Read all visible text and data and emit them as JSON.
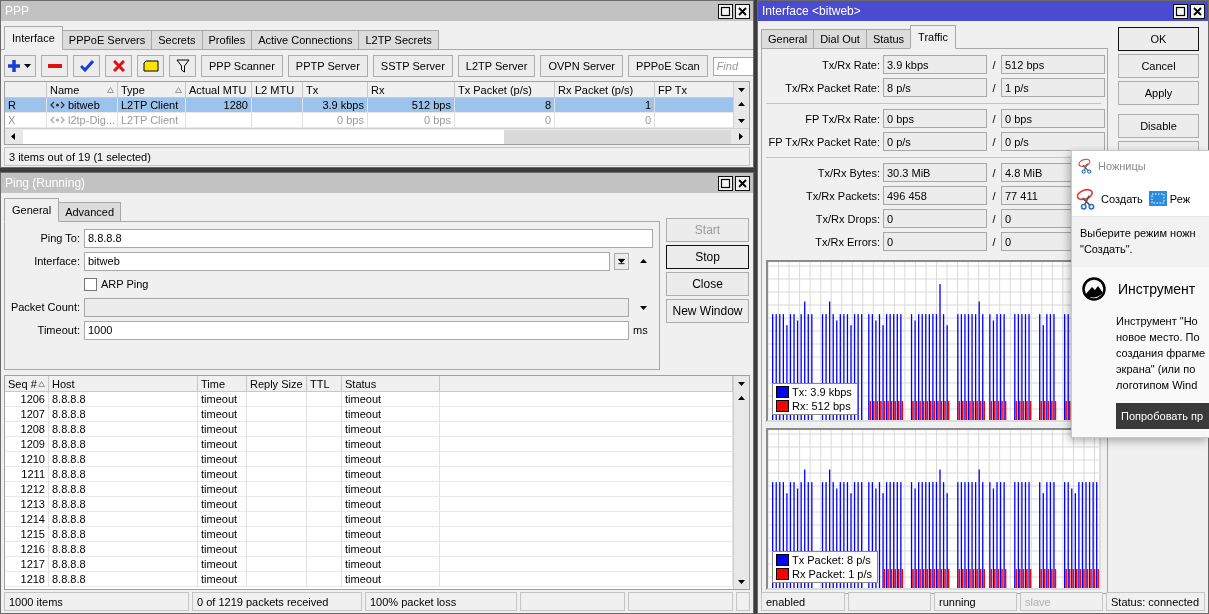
{
  "ppp": {
    "title": "PPP",
    "active": false,
    "tabs": [
      {
        "label": "Interface",
        "selected": true
      },
      {
        "label": "PPPoE Servers",
        "selected": false
      },
      {
        "label": "Secrets",
        "selected": false
      },
      {
        "label": "Profiles",
        "selected": false
      },
      {
        "label": "Active Connections",
        "selected": false
      },
      {
        "label": "L2TP Secrets",
        "selected": false
      }
    ],
    "toolbar_buttons": [
      "PPP Scanner",
      "PPTP Server",
      "SSTP Server",
      "L2TP Server",
      "OVPN Server",
      "PPPoE Scan"
    ],
    "find_placeholder": "Find",
    "columns": [
      {
        "label": "Name",
        "sorted": true
      },
      {
        "label": "Type",
        "sorted": true
      },
      {
        "label": "Actual MTU",
        "sorted": false
      },
      {
        "label": "L2 MTU",
        "sorted": false
      },
      {
        "label": "Tx",
        "sorted": false
      },
      {
        "label": "Rx",
        "sorted": false
      },
      {
        "label": "Tx Packet (p/s)",
        "sorted": false
      },
      {
        "label": "Rx Packet (p/s)",
        "sorted": false
      },
      {
        "label": "FP Tx",
        "sorted": false
      }
    ],
    "rows": [
      {
        "flag": "R",
        "name": "bitweb",
        "type": "L2TP Client",
        "actual_mtu": "1280",
        "tx": "3.9 kbps",
        "rx": "512 bps",
        "tx_packet": "8",
        "rx_packet": "1",
        "selected": true,
        "disabled": false
      },
      {
        "flag": "X",
        "name": "l2tp-Dig...",
        "type": "L2TP Client",
        "tx": "0 bps",
        "rx": "0 bps",
        "tx_packet": "0",
        "rx_packet": "0",
        "selected": false,
        "disabled": true
      }
    ],
    "status": "3 items out of 19 (1 selected)"
  },
  "ping": {
    "title": "Ping (Running)",
    "active": false,
    "tabs": [
      {
        "label": "General",
        "selected": true
      },
      {
        "label": "Advanced",
        "selected": false
      }
    ],
    "fields": [
      {
        "kind": "text",
        "label": "Ping To:",
        "value": "8.8.8.8",
        "disabled": false
      },
      {
        "kind": "select",
        "label": "Interface:",
        "value": "bitweb",
        "disabled": false
      },
      {
        "kind": "checkbox",
        "label": "ARP Ping",
        "checked": false
      },
      {
        "kind": "text",
        "label": "Packet Count:",
        "disabled": true
      },
      {
        "kind": "text",
        "label": "Timeout:",
        "value": "1000",
        "unit": "ms",
        "disabled": false
      }
    ],
    "buttons": [
      {
        "label": "Start",
        "disabled": true,
        "default": false
      },
      {
        "label": "Stop",
        "disabled": false,
        "default": true
      },
      {
        "label": "Close",
        "disabled": false,
        "default": false
      },
      {
        "label": "New Window",
        "disabled": false,
        "default": false
      }
    ],
    "columns": [
      {
        "label": "Seq #",
        "sorted": true
      },
      {
        "label": "Host",
        "sorted": false
      },
      {
        "label": "Time",
        "sorted": false
      },
      {
        "label": "Reply Size",
        "sorted": false
      },
      {
        "label": "TTL",
        "sorted": false
      },
      {
        "label": "Status",
        "sorted": false
      }
    ],
    "rows": [
      {
        "seq": "1206",
        "host": "8.8.8.8",
        "time": "timeout",
        "status": "timeout"
      },
      {
        "seq": "1207",
        "host": "8.8.8.8",
        "time": "timeout",
        "status": "timeout"
      },
      {
        "seq": "1208",
        "host": "8.8.8.8",
        "time": "timeout",
        "status": "timeout"
      },
      {
        "seq": "1209",
        "host": "8.8.8.8",
        "time": "timeout",
        "status": "timeout"
      },
      {
        "seq": "1210",
        "host": "8.8.8.8",
        "time": "timeout",
        "status": "timeout"
      },
      {
        "seq": "1211",
        "host": "8.8.8.8",
        "time": "timeout",
        "status": "timeout"
      },
      {
        "seq": "1212",
        "host": "8.8.8.8",
        "time": "timeout",
        "status": "timeout"
      },
      {
        "seq": "1213",
        "host": "8.8.8.8",
        "time": "timeout",
        "status": "timeout"
      },
      {
        "seq": "1214",
        "host": "8.8.8.8",
        "time": "timeout",
        "status": "timeout"
      },
      {
        "seq": "1215",
        "host": "8.8.8.8",
        "time": "timeout",
        "status": "timeout"
      },
      {
        "seq": "1216",
        "host": "8.8.8.8",
        "time": "timeout",
        "status": "timeout"
      },
      {
        "seq": "1217",
        "host": "8.8.8.8",
        "time": "timeout",
        "status": "timeout"
      },
      {
        "seq": "1218",
        "host": "8.8.8.8",
        "time": "timeout",
        "status": "timeout"
      }
    ],
    "status_bar": [
      "1000 items",
      "0 of 1219 packets received",
      "100% packet loss"
    ]
  },
  "interface": {
    "title": "Interface <bitweb>",
    "active": true,
    "tabs": [
      {
        "label": "General",
        "selected": false
      },
      {
        "label": "Dial Out",
        "selected": false
      },
      {
        "label": "Status",
        "selected": false
      },
      {
        "label": "Traffic",
        "selected": true
      }
    ],
    "stat_groups": [
      [
        {
          "label": "Tx/Rx Rate:",
          "tx": "3.9 kbps",
          "sep": "/",
          "rx": "512 bps"
        },
        {
          "label": "Tx/Rx Packet Rate:",
          "tx": "8 p/s",
          "sep": "/",
          "rx": "1 p/s"
        }
      ],
      [
        {
          "label": "FP Tx/Rx Rate:",
          "tx": "0 bps",
          "sep": "/",
          "rx": "0 bps"
        },
        {
          "label": "FP Tx/Rx Packet Rate:",
          "tx": "0 p/s",
          "sep": "/",
          "rx": "0 p/s"
        }
      ],
      [
        {
          "label": "Tx/Rx Bytes:",
          "tx": "30.3 MiB",
          "sep": "/",
          "rx": "4.8 MiB"
        },
        {
          "label": "Tx/Rx Packets:",
          "tx": "496 458",
          "sep": "/",
          "rx": "77 411"
        },
        {
          "label": "Tx/Rx Drops:",
          "tx": "0",
          "sep": "/",
          "rx": "0"
        },
        {
          "label": "Tx/Rx Errors:",
          "tx": "0",
          "sep": "/",
          "rx": "0"
        }
      ]
    ],
    "charts": [
      {
        "legend": [
          {
            "label": "Tx:",
            "value": "3.9 kbps",
            "color": "#0000ff"
          },
          {
            "label": "Rx:",
            "value": "512 bps",
            "color": "#ff0000"
          }
        ]
      },
      {
        "legend": [
          {
            "label": "Tx Packet:",
            "value": "8 p/s",
            "color": "#0000ff"
          },
          {
            "label": "Rx Packet:",
            "value": "1 p/s",
            "color": "#ff0000"
          }
        ]
      }
    ],
    "buttons": [
      {
        "label": "OK",
        "default": true
      },
      {
        "label": "Cancel",
        "default": false
      },
      {
        "label": "Apply",
        "default": false
      },
      {
        "label": "Disable",
        "default": false
      },
      {
        "default": false
      }
    ],
    "status_bar": [
      {
        "text": "enabled",
        "disabled": false
      },
      {
        "text": "running",
        "disabled": false
      },
      {
        "text": "slave",
        "disabled": true
      },
      {
        "text": "Status: connected",
        "disabled": false
      }
    ]
  },
  "snipping": {
    "title": "Ножницы",
    "new_label": "Создать",
    "mode_label": "Реж",
    "hint": "Выберите режим ножн\n\"Создать\".",
    "notice_title": "Инструмент",
    "notice_text": "Инструмент \"Но\nновое место. По\nсоздания фрагме\nэкрана\" (или по\nлоготипом Wind",
    "try_button": "Попробовать пр"
  }
}
